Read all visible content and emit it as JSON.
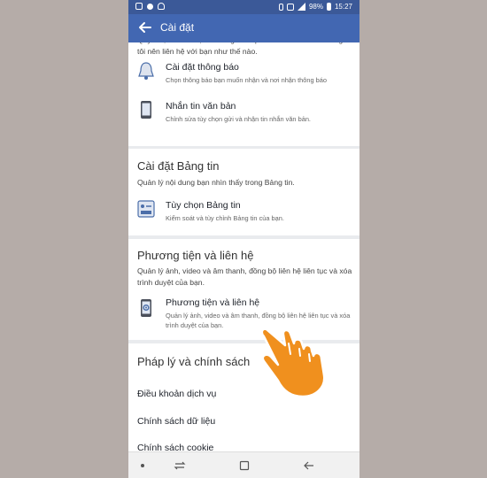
{
  "statusbar": {
    "battery": "98%",
    "time": "15:27"
  },
  "header": {
    "title": "Cài đặt"
  },
  "section_top": {
    "partial_desc": "Quyết định cách bạn muốn giao tiếp trên Facebook và chúng tôi nên liên hệ với bạn như thế nào.",
    "items": [
      {
        "label": "Cài đặt thông báo",
        "desc": "Chọn thông báo bạn muốn nhận và nơi nhận thông báo"
      },
      {
        "label": "Nhắn tin văn bản",
        "desc": "Chỉnh sửa tùy chọn gửi và nhận tin nhắn văn bản."
      }
    ]
  },
  "section_news_feed": {
    "title": "Cài đặt Bảng tin",
    "desc": "Quản lý nội dung bạn nhìn thấy trong Bảng tin.",
    "items": [
      {
        "label": "Tùy chọn Bảng tin",
        "desc": "Kiểm soát và tùy chỉnh Bảng tin của bạn."
      }
    ]
  },
  "section_media": {
    "title": "Phương tiện và liên hệ",
    "desc": "Quản lý ảnh, video và âm thanh, đồng bộ liên hệ liên tục và xóa trình duyệt của bạn.",
    "items": [
      {
        "label": "Phương tiện và liên hệ",
        "desc": "Quản lý ảnh, video và âm thanh, đồng bộ liên hệ liên tục và xóa trình duyệt của bạn."
      }
    ]
  },
  "section_legal": {
    "title": "Pháp lý và chính sách",
    "links": [
      "Điều khoản dịch vụ",
      "Chính sách dữ liệu",
      "Chính sách cookie"
    ]
  },
  "colors": {
    "facebook_blue": "#4267b2",
    "statusbar_blue": "#3b5998",
    "hand_orange": "#f0901e"
  }
}
